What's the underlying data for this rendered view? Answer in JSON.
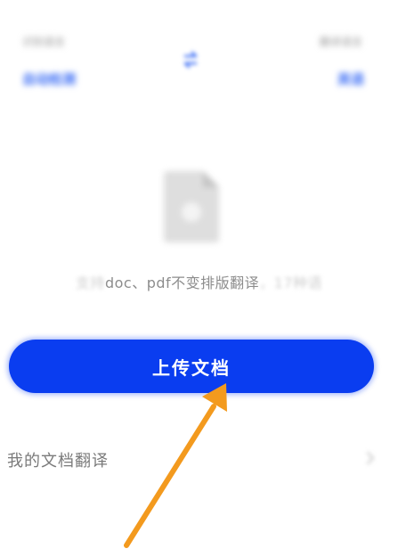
{
  "language_bar": {
    "source_caption": "识别语言",
    "source_value": "自动检测",
    "target_caption": "翻译语言",
    "target_value": "英语",
    "swap_icon": "swap-arrows-icon"
  },
  "upload_area": {
    "file_icon": "document-icon",
    "formats_prefix": "支持",
    "formats_main": "doc、pdf不变排版翻译",
    "formats_suffix": "，17种语"
  },
  "upload_button": {
    "label": "上传文档"
  },
  "my_documents": {
    "label": "我的文档翻译",
    "chevron_icon": "chevron-right-icon"
  },
  "annotation": {
    "pointer_icon": "arrow-pointer-icon"
  },
  "colors": {
    "accent": "#0a3df0",
    "link_blue": "#3e6ff5",
    "annotation_orange": "#f39a1e"
  }
}
